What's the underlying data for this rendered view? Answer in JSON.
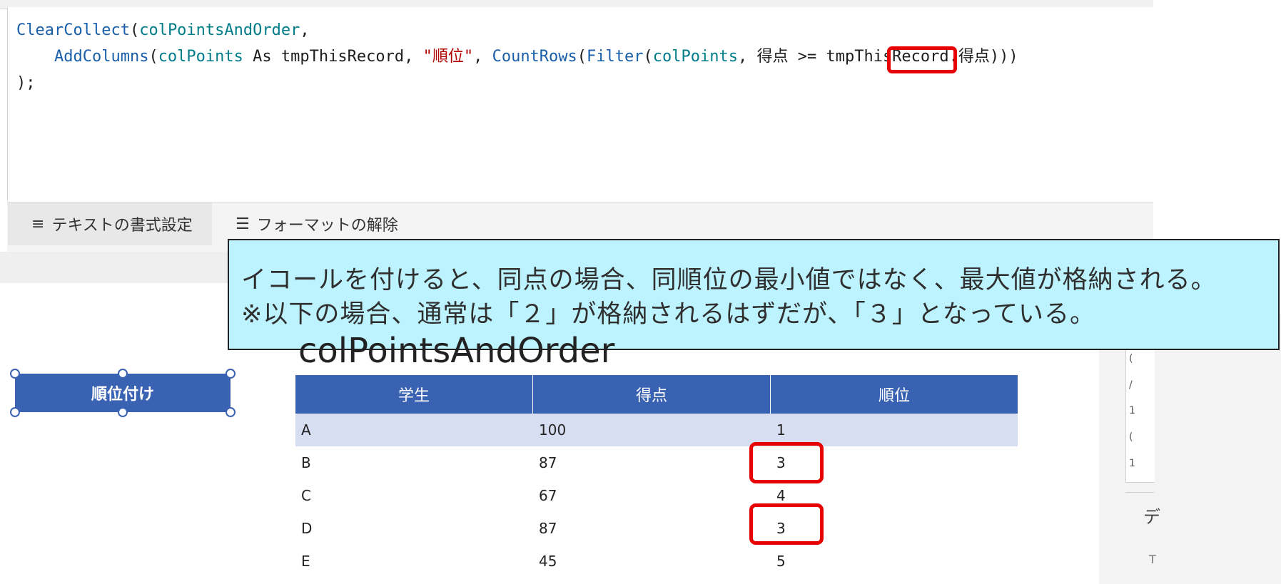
{
  "editor": {
    "code_line1_fn": "ClearCollect",
    "code_line1_open": "(",
    "code_line1_var": "colPointsAndOrder",
    "code_line1_end": ",",
    "code_line2_indent": "    ",
    "code_line2_fn1": "AddColumns",
    "code_line2_p1": "(",
    "code_line2_var1": "colPoints",
    "code_line2_as": " As tmpThisRecord, ",
    "code_line2_str": "\"順位\"",
    "code_line2_comma": ", ",
    "code_line2_fn2": "CountRows",
    "code_line2_p2": "(",
    "code_line2_fn3": "Filter",
    "code_line2_p3": "(",
    "code_line2_var2": "colPoints",
    "code_line2_rest": ", 得点 >= tmpThisRecord.得点)))",
    "code_line3": ");"
  },
  "formula_bar": {
    "format_text_label": "テキストの書式設定",
    "remove_format_label": "フォーマットの解除"
  },
  "callout": {
    "line1": "イコールを付けると、同点の場合、同順位の最小値ではなく、最大値が格納される。",
    "line2": "※以下の場合、通常は「２」が格納されるはずだが、「３」となっている。"
  },
  "canvas": {
    "rank_button_label": "順位付け",
    "table_title": "colPointsAndOrder"
  },
  "table": {
    "headers": [
      "学生",
      "得点",
      "順位"
    ],
    "rows": [
      [
        "A",
        "100",
        "1"
      ],
      [
        "B",
        "87",
        "3"
      ],
      [
        "C",
        "67",
        "4"
      ],
      [
        "D",
        "87",
        "3"
      ],
      [
        "E",
        "45",
        "5"
      ]
    ]
  },
  "right_panel": {
    "chars": [
      "(",
      "/",
      "1",
      "(",
      "1"
    ],
    "label_de": "デ",
    "label_t": "T"
  },
  "colors": {
    "accent": "#3a62b3",
    "highlight": "#e60000",
    "callout_bg": "#bdf3ff"
  }
}
